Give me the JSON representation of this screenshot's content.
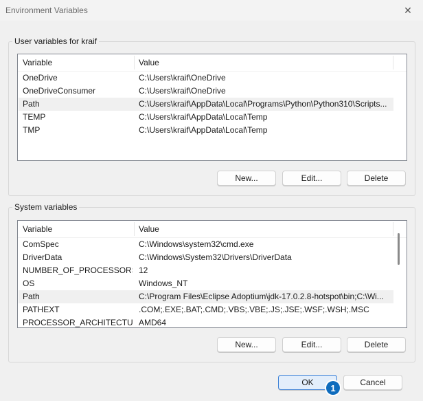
{
  "window": {
    "title": "Environment Variables",
    "close_glyph": "✕"
  },
  "user_section": {
    "label": "User variables for kraif",
    "columns": [
      "Variable",
      "Value"
    ],
    "rows": [
      {
        "variable": "OneDrive",
        "value": "C:\\Users\\kraif\\OneDrive"
      },
      {
        "variable": "OneDriveConsumer",
        "value": "C:\\Users\\kraif\\OneDrive"
      },
      {
        "variable": "Path",
        "value": "C:\\Users\\kraif\\AppData\\Local\\Programs\\Python\\Python310\\Scripts..."
      },
      {
        "variable": "TEMP",
        "value": "C:\\Users\\kraif\\AppData\\Local\\Temp"
      },
      {
        "variable": "TMP",
        "value": "C:\\Users\\kraif\\AppData\\Local\\Temp"
      }
    ],
    "buttons": {
      "new": "New...",
      "edit": "Edit...",
      "delete": "Delete"
    }
  },
  "system_section": {
    "label": "System variables",
    "columns": [
      "Variable",
      "Value"
    ],
    "rows": [
      {
        "variable": "ComSpec",
        "value": "C:\\Windows\\system32\\cmd.exe"
      },
      {
        "variable": "DriverData",
        "value": "C:\\Windows\\System32\\Drivers\\DriverData"
      },
      {
        "variable": "NUMBER_OF_PROCESSORS",
        "value": "12"
      },
      {
        "variable": "OS",
        "value": "Windows_NT"
      },
      {
        "variable": "Path",
        "value": "C:\\Program Files\\Eclipse Adoptium\\jdk-17.0.2.8-hotspot\\bin;C:\\Wi..."
      },
      {
        "variable": "PATHEXT",
        "value": ".COM;.EXE;.BAT;.CMD;.VBS;.VBE;.JS;.JSE;.WSF;.WSH;.MSC"
      },
      {
        "variable": "PROCESSOR_ARCHITECTURE",
        "value": "AMD64"
      }
    ],
    "buttons": {
      "new": "New...",
      "edit": "Edit...",
      "delete": "Delete"
    }
  },
  "footer": {
    "ok": "OK",
    "cancel": "Cancel"
  },
  "annotation_badge": "1"
}
